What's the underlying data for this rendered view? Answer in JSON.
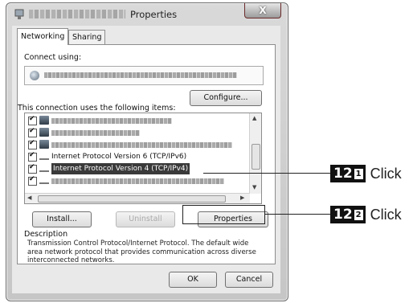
{
  "window": {
    "title": "Properties",
    "close_symbol": "X"
  },
  "tabs": [
    {
      "label": "Networking"
    },
    {
      "label": "Sharing"
    }
  ],
  "connect_using_label": "Connect using:",
  "configure_button": "Configure...",
  "items_label": "This connection uses the following items:",
  "items": [
    {
      "label": "",
      "checked": true
    },
    {
      "label": "",
      "checked": true
    },
    {
      "label": "",
      "checked": true
    },
    {
      "label": "Internet Protocol Version 6 (TCP/IPv6)",
      "checked": true
    },
    {
      "label": "Internet Protocol Version 4 (TCP/IPv4)",
      "checked": true,
      "selected": true
    },
    {
      "label": "",
      "checked": true
    }
  ],
  "buttons": {
    "install": "Install...",
    "uninstall": "Uninstall",
    "properties": "Properties",
    "ok": "OK",
    "cancel": "Cancel"
  },
  "description": {
    "heading": "Description",
    "text": "Transmission Control Protocol/Internet Protocol. The default wide area network protocol that provides communication across diverse interconnected networks."
  },
  "callouts": [
    {
      "step": "12",
      "sub": "1",
      "text": "Click"
    },
    {
      "step": "12",
      "sub": "2",
      "text": "Click"
    }
  ]
}
